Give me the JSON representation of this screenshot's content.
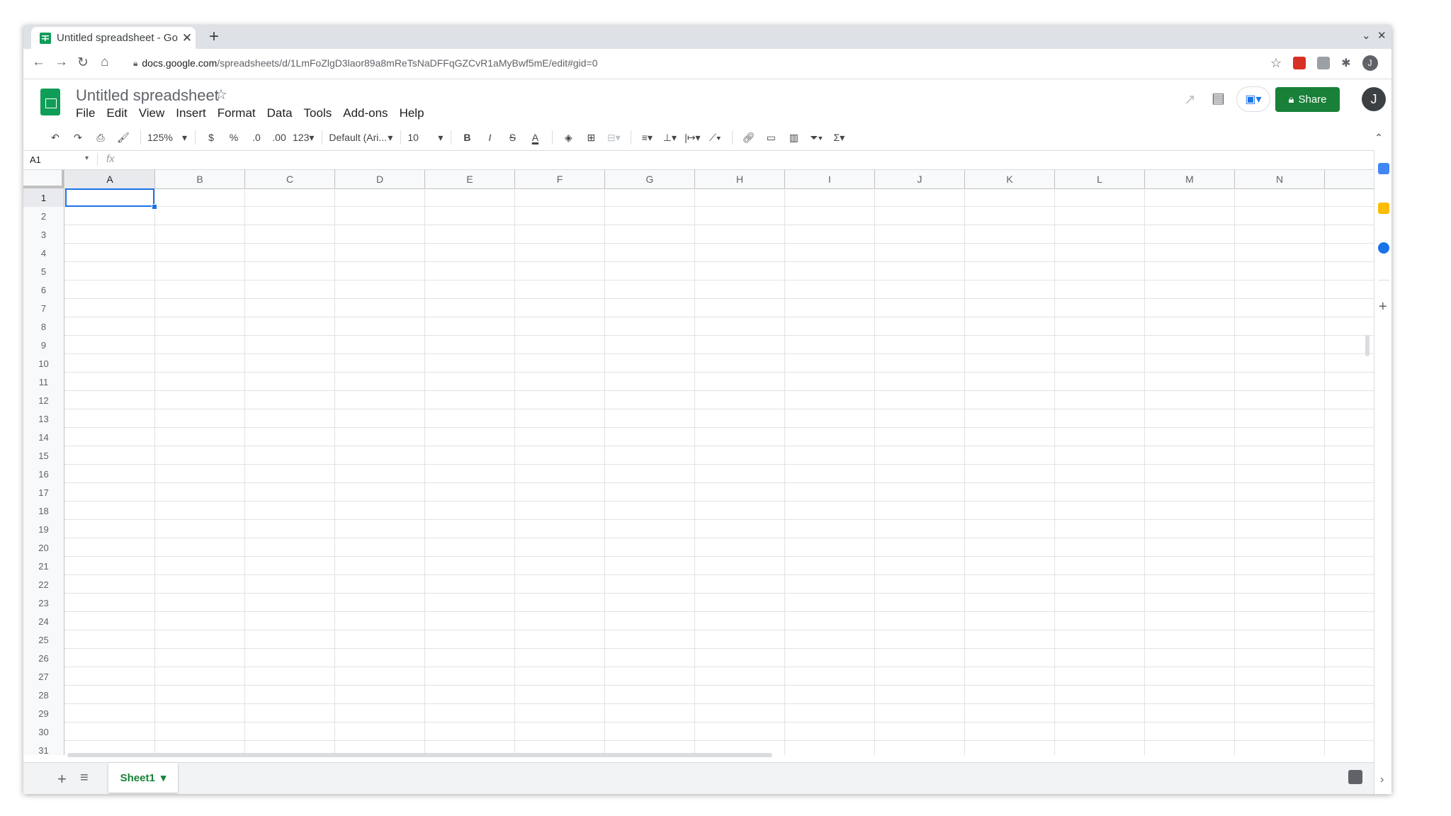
{
  "browser": {
    "tab_title": "Untitled spreadsheet - Go",
    "tab_close": "✕",
    "new_tab": "+",
    "url_domain": "docs.google.com",
    "url_path": "/spreadsheets/d/1LmFoZlgD3laor89a8mReTsNaDFFqGZCvR1aMyBwf5mE/edit#gid=0",
    "profile_initial": "J",
    "minimize_glyph": "⌄",
    "close_glyph": "✕"
  },
  "app": {
    "doc_title": "Untitled spreadsheet",
    "menu": [
      "File",
      "Edit",
      "View",
      "Insert",
      "Format",
      "Data",
      "Tools",
      "Add-ons",
      "Help"
    ],
    "share_label": "Share",
    "avatar_initial": "J"
  },
  "toolbar": {
    "zoom": "125%",
    "currency": "$",
    "percent": "%",
    "decrease_decimals": ".0",
    "increase_decimals": ".00",
    "more_formats": "123",
    "font": "Default (Ari...",
    "font_size": "10",
    "bold": "B",
    "italic": "I",
    "strikethrough": "S",
    "text_color": "A",
    "sum": "Σ"
  },
  "formula_bar": {
    "name_box": "A1",
    "fx": "fx",
    "value": ""
  },
  "grid": {
    "columns": [
      "A",
      "B",
      "C",
      "D",
      "E",
      "F",
      "G",
      "H",
      "I",
      "J",
      "K",
      "L",
      "M",
      "N"
    ],
    "rows": [
      "1",
      "2",
      "3",
      "4",
      "5",
      "6",
      "7",
      "8",
      "9",
      "10",
      "11",
      "12",
      "13",
      "14",
      "15",
      "16",
      "17",
      "18",
      "19",
      "20",
      "21",
      "22",
      "23",
      "24",
      "25",
      "26",
      "27",
      "28",
      "29",
      "30",
      "31"
    ],
    "selected_cell": "A1"
  },
  "sheets": {
    "tabs": [
      "Sheet1"
    ],
    "active": "Sheet1"
  },
  "colors": {
    "accent_green": "#188038",
    "selection_blue": "#1a73e8"
  }
}
